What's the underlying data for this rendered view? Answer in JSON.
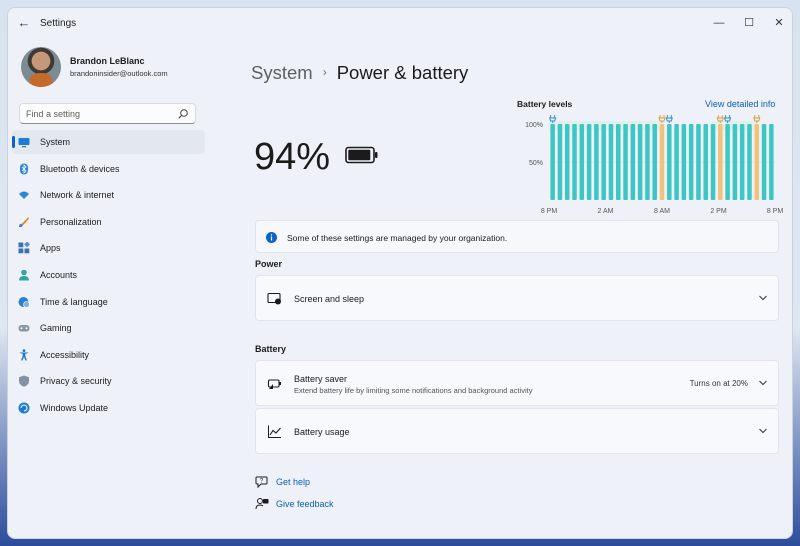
{
  "window": {
    "title": "Settings",
    "controls": {
      "minimize": "—",
      "maximize": "☐",
      "close": "✕"
    }
  },
  "profile": {
    "name": "Brandon LeBlanc",
    "email": "brandoninsider@outlook.com"
  },
  "search": {
    "placeholder": "Find a setting",
    "icon": "search-icon"
  },
  "sidebar": {
    "items": [
      {
        "label": "System",
        "icon": "monitor-icon",
        "active": true
      },
      {
        "label": "Bluetooth & devices",
        "icon": "bluetooth-icon"
      },
      {
        "label": "Network & internet",
        "icon": "wifi-icon"
      },
      {
        "label": "Personalization",
        "icon": "brush-icon"
      },
      {
        "label": "Apps",
        "icon": "apps-icon"
      },
      {
        "label": "Accounts",
        "icon": "person-icon"
      },
      {
        "label": "Time & language",
        "icon": "globe-clock-icon"
      },
      {
        "label": "Gaming",
        "icon": "gamepad-icon"
      },
      {
        "label": "Accessibility",
        "icon": "accessibility-icon"
      },
      {
        "label": "Privacy & security",
        "icon": "shield-icon"
      },
      {
        "label": "Windows Update",
        "icon": "update-icon"
      }
    ]
  },
  "breadcrumb": {
    "parent": "System",
    "separator": "›",
    "current": "Power & battery"
  },
  "battery": {
    "percent": "94%",
    "level": 0.94
  },
  "battery_chart": {
    "title": "Battery levels",
    "link": "View detailed info",
    "y_ticks": [
      "100%",
      "50%"
    ],
    "x_ticks": [
      "8 PM",
      "2 AM",
      "8 AM",
      "2 PM",
      "8 PM"
    ],
    "bars": [
      {
        "level": 100,
        "charging": false
      },
      {
        "level": 100,
        "charging": false
      },
      {
        "level": 100,
        "charging": false
      },
      {
        "level": 100,
        "charging": false
      },
      {
        "level": 100,
        "charging": false
      },
      {
        "level": 100,
        "charging": false
      },
      {
        "level": 100,
        "charging": false
      },
      {
        "level": 100,
        "charging": false
      },
      {
        "level": 100,
        "charging": false
      },
      {
        "level": 100,
        "charging": false
      },
      {
        "level": 100,
        "charging": false
      },
      {
        "level": 100,
        "charging": false
      },
      {
        "level": 100,
        "charging": false
      },
      {
        "level": 100,
        "charging": false
      },
      {
        "level": 100,
        "charging": false
      },
      {
        "level": 100,
        "charging": true
      },
      {
        "level": 100,
        "charging": false
      },
      {
        "level": 100,
        "charging": false
      },
      {
        "level": 100,
        "charging": false
      },
      {
        "level": 100,
        "charging": false
      },
      {
        "level": 100,
        "charging": false
      },
      {
        "level": 100,
        "charging": false
      },
      {
        "level": 100,
        "charging": false
      },
      {
        "level": 100,
        "charging": true
      },
      {
        "level": 100,
        "charging": false
      },
      {
        "level": 100,
        "charging": false
      },
      {
        "level": 100,
        "charging": false
      },
      {
        "level": 100,
        "charging": false
      },
      {
        "level": 100,
        "charging": true
      },
      {
        "level": 100,
        "charging": false
      },
      {
        "level": 100,
        "charging": false
      }
    ],
    "plug_markers": [
      0,
      15,
      16,
      23,
      24,
      28
    ],
    "colors": {
      "battery": "#3ec6c4",
      "charging": "#f1c27a",
      "plugged_bg": "#e0f0ed"
    }
  },
  "banner": {
    "text": "Some of these settings are managed by your organization."
  },
  "power_section": {
    "label": "Power",
    "screen_sleep": {
      "title": "Screen and sleep"
    }
  },
  "battery_section": {
    "label": "Battery",
    "saver": {
      "title": "Battery saver",
      "description": "Extend battery life by limiting some notifications and background activity",
      "value": "Turns on at 20%"
    },
    "usage": {
      "title": "Battery usage"
    }
  },
  "help": {
    "get_help": "Get help",
    "give_feedback": "Give feedback"
  },
  "colors": {
    "accent": "#0a63c9",
    "link": "#0a5fb8"
  }
}
